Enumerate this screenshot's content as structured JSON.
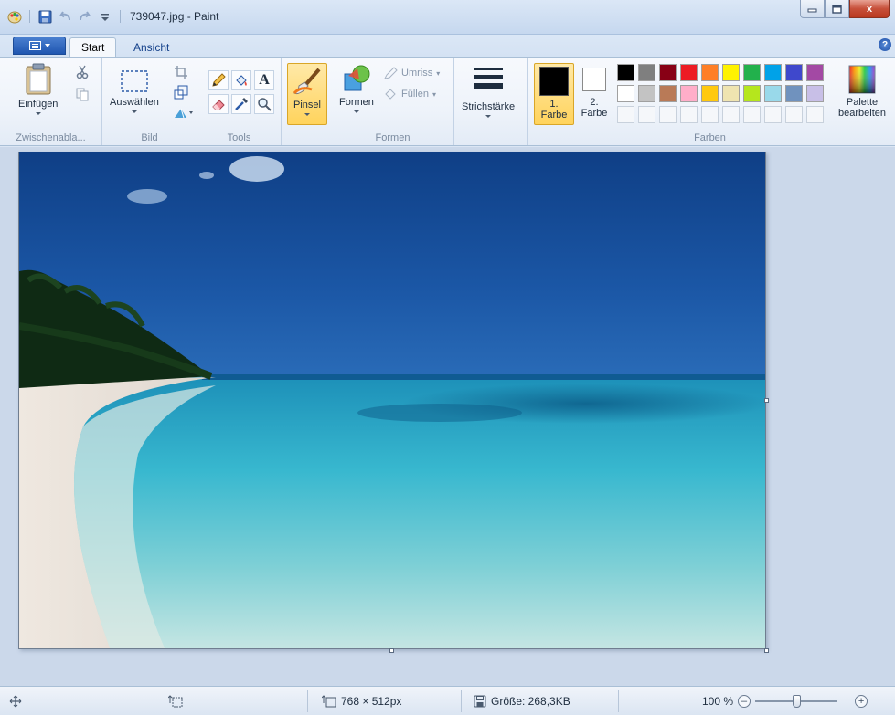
{
  "window": {
    "title": "739047.jpg - Paint",
    "controls": {
      "minimize": "▭",
      "maximize": "▣",
      "close": "x"
    }
  },
  "tabs": [
    {
      "label": "Start"
    },
    {
      "label": "Ansicht"
    }
  ],
  "ribbon": {
    "clipboard": {
      "label": "Zwischenabla...",
      "paste": "Einfügen"
    },
    "image": {
      "label": "Bild",
      "select": "Auswählen"
    },
    "tools": {
      "label": "Tools"
    },
    "brushes": {
      "label": "Pinsel"
    },
    "shapes": {
      "label": "Formen",
      "button": "Formen",
      "outline": "Umriss",
      "fill": "Füllen"
    },
    "size": {
      "label": "Strichstärke"
    },
    "colors": {
      "label": "Farben",
      "color1": "1. Farbe",
      "color1_lines": [
        "1.",
        "Farbe"
      ],
      "color2_lines": [
        "2.",
        "Farbe"
      ],
      "color1_value": "#000000",
      "color2_value": "#ffffff",
      "edit_palette_lines": [
        "Palette",
        "bearbeiten"
      ],
      "palette": [
        "#000000",
        "#7f7f7f",
        "#880015",
        "#ed1c24",
        "#ff7f27",
        "#fff200",
        "#22b14c",
        "#00a2e8",
        "#3f48cc",
        "#a349a4",
        "#ffffff",
        "#c3c3c3",
        "#b97a57",
        "#ffaec9",
        "#ffc90e",
        "#efe4b0",
        "#b5e61d",
        "#99d9ea",
        "#7092be",
        "#c8bfe7"
      ]
    }
  },
  "status": {
    "dimensions": "768 × 512px",
    "size": "Größe: 268,3KB",
    "zoom": "100 %",
    "zoom_level": 0.5
  },
  "help": "?"
}
